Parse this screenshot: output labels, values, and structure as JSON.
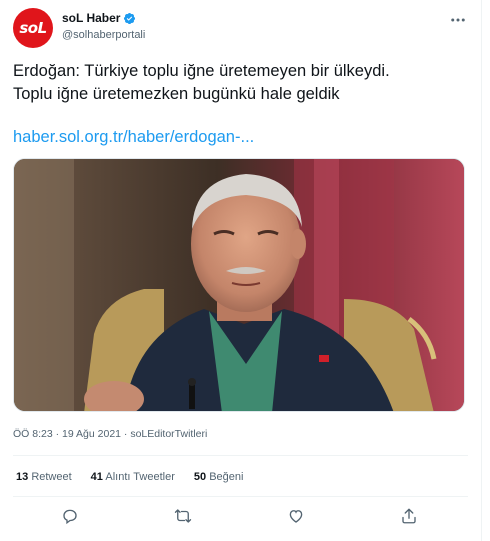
{
  "author": {
    "avatar_text": "soL",
    "display_name": "soL Haber",
    "handle": "@solhaberportali",
    "verified": true
  },
  "tweet": {
    "text_line1": "Erdoğan: Türkiye toplu iğne üretemeyen bir ülkeydi.",
    "text_line2": "Toplu iğne üretemezken bugünkü hale geldik",
    "link": "haber.sol.org.tr/haber/erdogan-..."
  },
  "meta": {
    "line": "ÖÖ 8:23 · 19 Ağu 2021 · soLEditorTwitleri"
  },
  "stats": {
    "retweet_count": "13",
    "retweet_label": "Retweet",
    "quote_count": "41",
    "quote_label": "Alıntı Tweetler",
    "like_count": "50",
    "like_label": "Beğeni"
  },
  "colors": {
    "accent": "#1d9bf0",
    "brand": "#e0151b",
    "muted": "#536471"
  },
  "icons": {
    "more": "more-dots-icon",
    "reply": "reply-icon",
    "retweet": "retweet-icon",
    "like": "heart-icon",
    "share": "share-icon",
    "verified": "verified-badge-icon"
  }
}
